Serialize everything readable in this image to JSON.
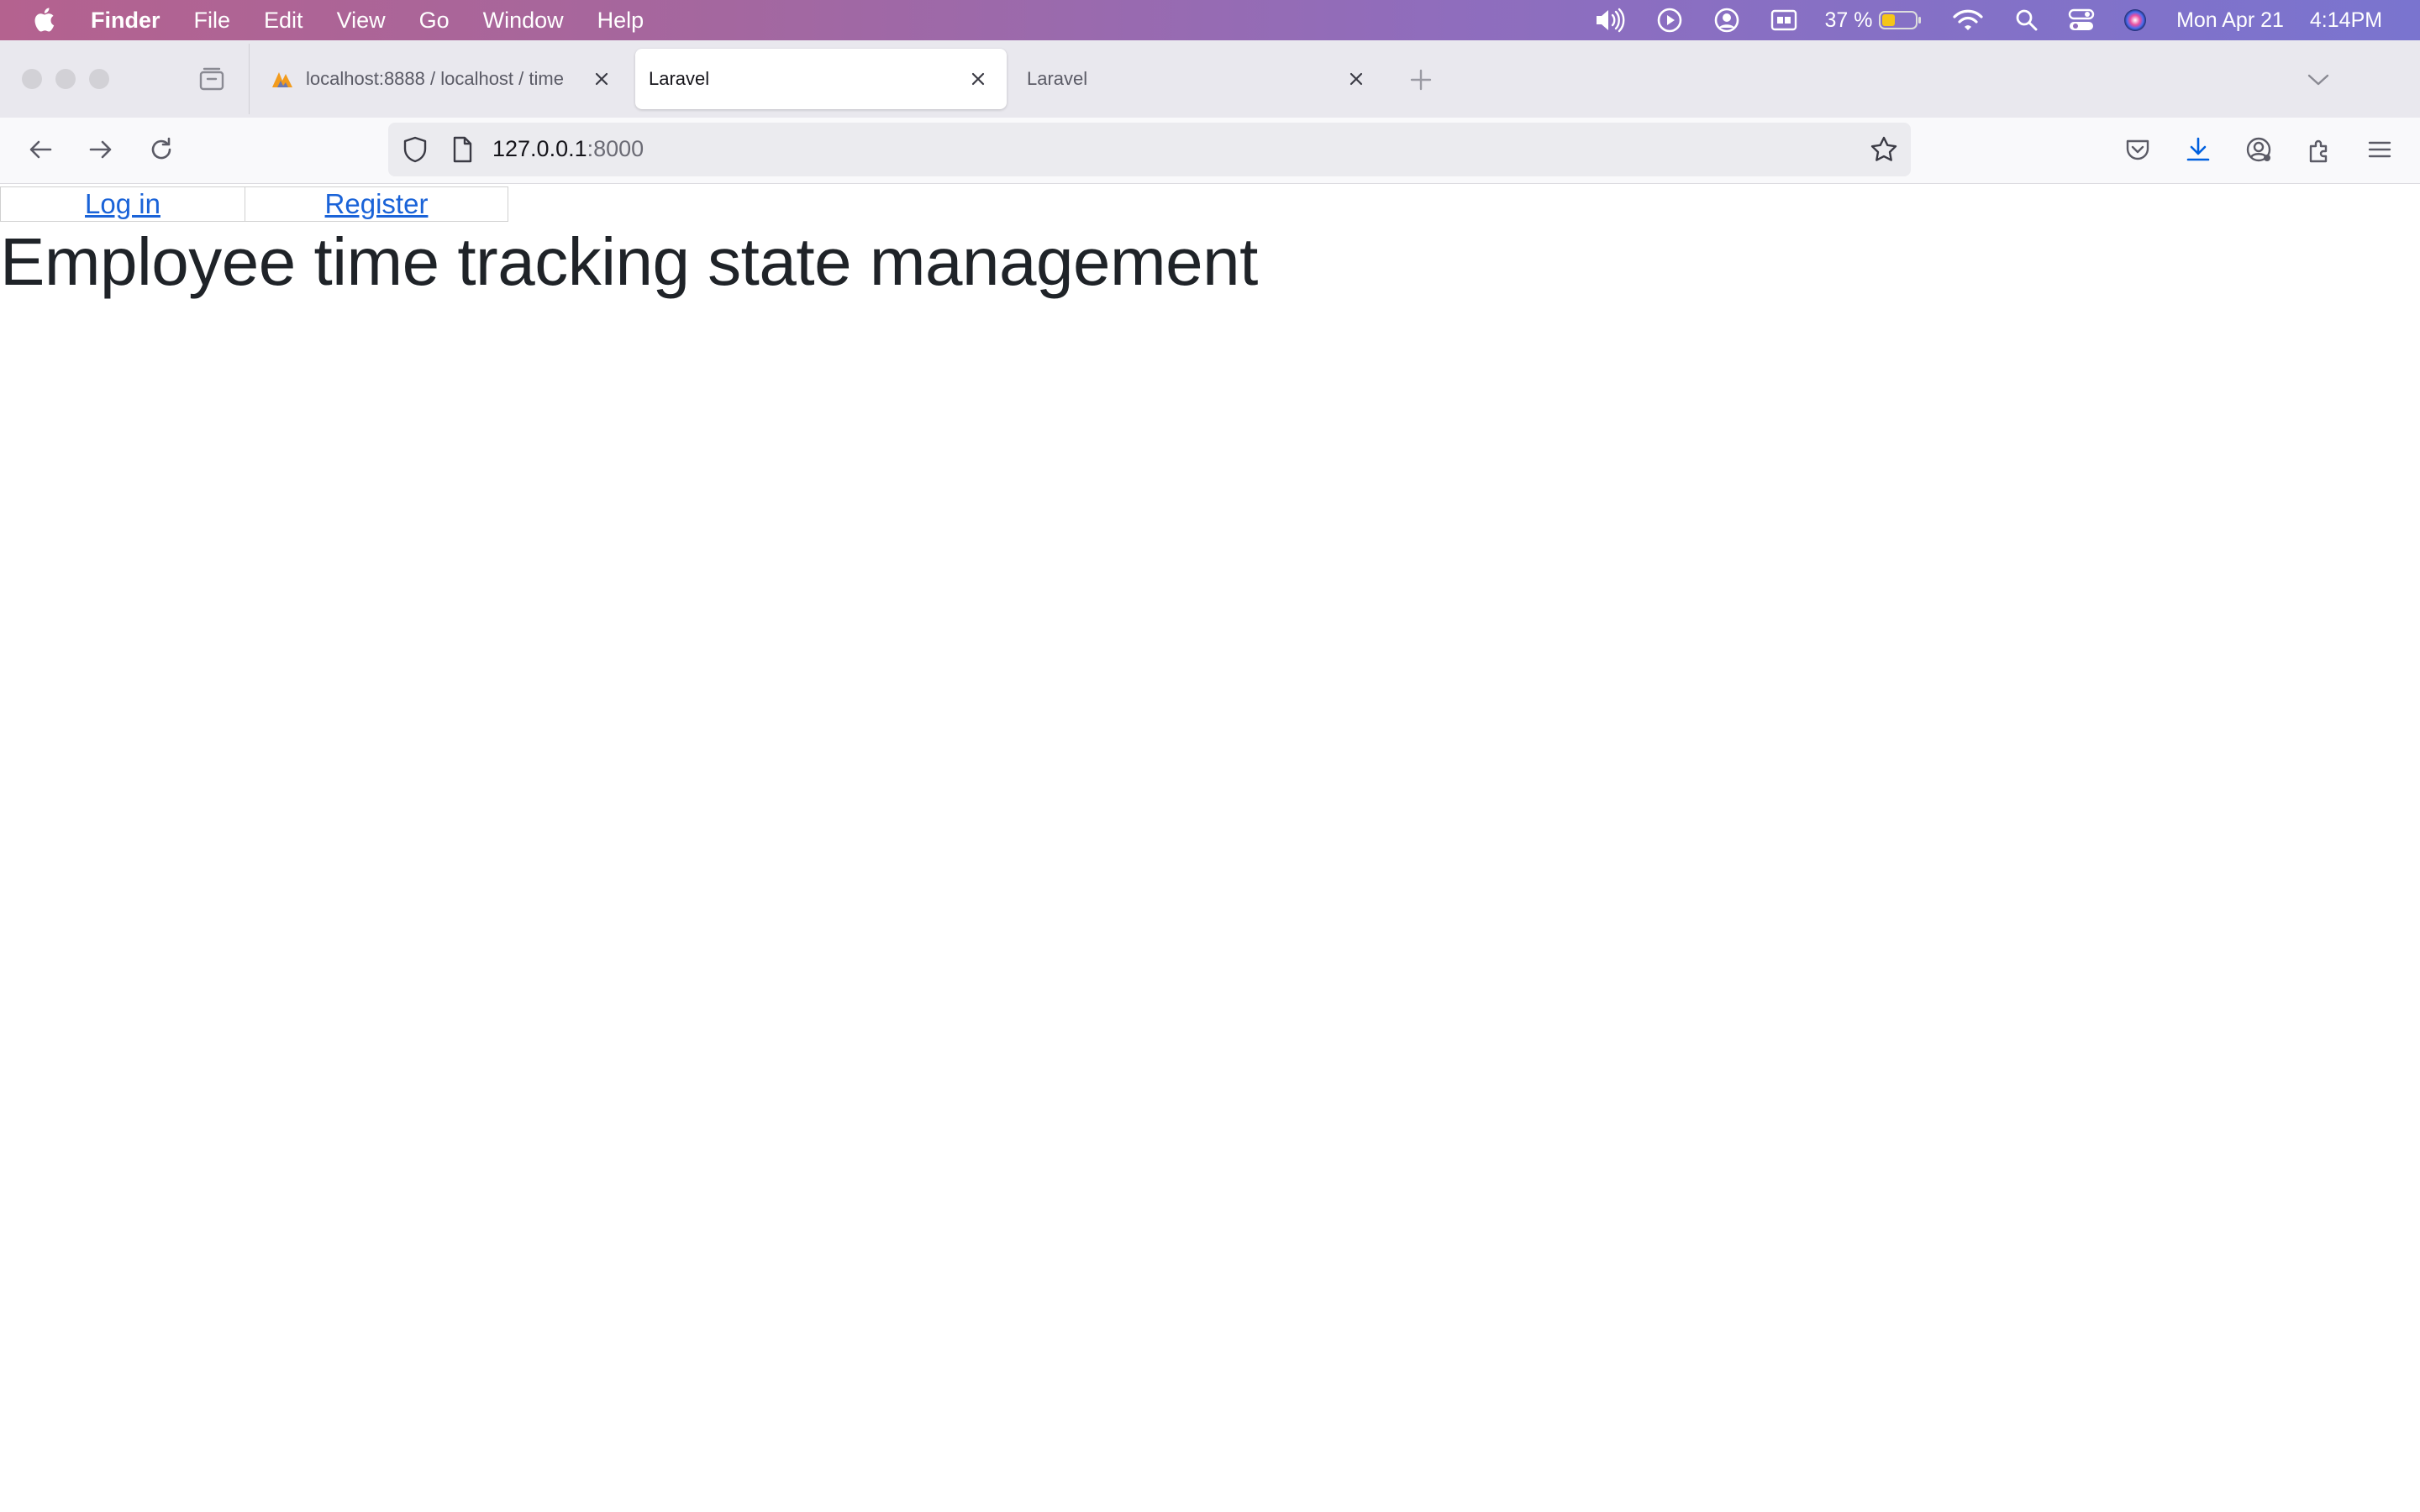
{
  "menubar": {
    "app_name": "Finder",
    "menus": [
      "File",
      "Edit",
      "View",
      "Go",
      "Window",
      "Help"
    ],
    "battery_percent": "37 %",
    "date": "Mon Apr 21",
    "time": "4:14PM",
    "icons": [
      "apple-icon",
      "volume-icon",
      "play-icon",
      "user-icon",
      "display-icon",
      "battery-icon",
      "wifi-icon",
      "search-icon",
      "control-center-icon",
      "siri-icon"
    ]
  },
  "browser": {
    "tabs": [
      {
        "title": "localhost:8888 / localhost / time",
        "favicon": "phpmyadmin-icon",
        "active": false
      },
      {
        "title": "Laravel",
        "active": true
      },
      {
        "title": "Laravel",
        "active": false
      }
    ],
    "url": {
      "host": "127.0.0.1",
      "port": ":8000"
    },
    "accent_color": "#0060df"
  },
  "page": {
    "nav": {
      "login_label": "Log in",
      "register_label": "Register"
    },
    "title": "Employee time tracking state management",
    "link_color": "#1a63d8",
    "title_color": "#1f2328"
  }
}
